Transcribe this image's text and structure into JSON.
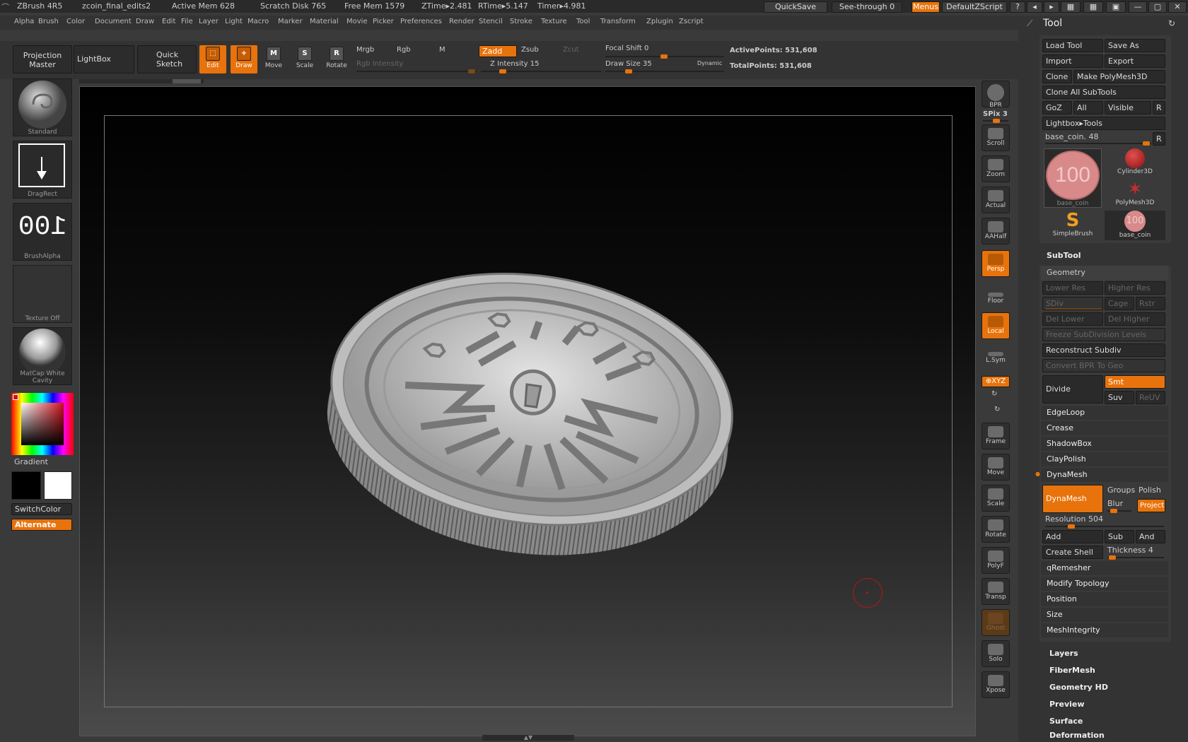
{
  "app": {
    "name": "ZBrush 4R5",
    "document": "zcoin_final_edits2",
    "active_mem": "Active Mem 628",
    "scratch_disk": "Scratch Disk 765",
    "free_mem": "Free Mem 1579",
    "ztime": "ZTime▸2.481",
    "rtime": "RTime▸5.147",
    "timer": "Timer▸4.981",
    "quicksave": "QuickSave",
    "see_through": "See-through  0",
    "menus": "Menus",
    "default_zscript": "DefaultZScript"
  },
  "menubar": [
    "Alpha",
    "Brush",
    "Color",
    "Document",
    "Draw",
    "Edit",
    "File",
    "Layer",
    "Light",
    "Macro",
    "Marker",
    "Material",
    "Movie",
    "Picker",
    "Preferences",
    "Render",
    "Stencil",
    "Stroke",
    "Texture",
    "Tool",
    "Transform",
    "Zplugin",
    "Zscript"
  ],
  "shelf": {
    "projection_master": "Projection\nMaster",
    "lightbox": "LightBox",
    "quick_sketch": "Quick\nSketch",
    "edit": "Edit",
    "draw": "Draw",
    "move": "Move",
    "scale": "Scale",
    "rotate": "Rotate",
    "mrgb": "Mrgb",
    "rgb": "Rgb",
    "m": "M",
    "rgb_intensity": "Rgb Intensity",
    "zadd": "Zadd",
    "zsub": "Zsub",
    "zcut": "Zcut",
    "z_intensity": "Z Intensity 15",
    "focal_shift": "Focal Shift 0",
    "draw_size": "Draw Size 35",
    "dynamic": "Dynamic",
    "active_points": "ActivePoints: 531,608",
    "total_points": "TotalPoints: 531,608",
    "z_intensity_value": 15,
    "z_intensity_max": 100,
    "focal_shift_value": 0,
    "draw_size_value": 35
  },
  "left": {
    "brush": "Standard",
    "stroke": "DragRect",
    "alpha": "BrushAlpha",
    "alpha_glyph": "100",
    "texture": "Texture Off",
    "material": "MatCap White Cavity",
    "gradient": "Gradient",
    "switch_color": "SwitchColor",
    "alternate": "Alternate"
  },
  "right_strip": {
    "bpr": "BPR",
    "spix": "SPix 3",
    "scroll": "Scroll",
    "zoom": "Zoom",
    "actual": "Actual",
    "aahalf": "AAHalf",
    "persp": "Persp",
    "floor": "Floor",
    "local": "Local",
    "lsym": "L.Sym",
    "xyz": "⊕XYZ",
    "frame": "Frame",
    "move": "Move",
    "scale": "Scale",
    "rotate": "Rotate",
    "polyf": "PolyF",
    "transp": "Transp",
    "ghost": "Ghost",
    "solo": "Solo",
    "xpose": "Xpose"
  },
  "tool_panel": {
    "title": "Tool",
    "load_tool": "Load Tool",
    "save_as": "Save As",
    "import": "Import",
    "export": "Export",
    "clone": "Clone",
    "make_polymesh": "Make PolyMesh3D",
    "clone_all": "Clone All SubTools",
    "goz": "GoZ",
    "all": "All",
    "visible": "Visible",
    "r": "R",
    "lightbox_tools": "Lightbox▸Tools",
    "current_tool": "base_coin. 48",
    "thumbs": [
      {
        "label": "base_coin",
        "glyph": "100"
      },
      {
        "label": "Cylinder3D"
      },
      {
        "label": "PolyMesh3D"
      },
      {
        "label": "SimpleBrush"
      },
      {
        "label": "base_coin",
        "glyph": "100"
      }
    ],
    "subtool": "SubTool",
    "geometry": "Geometry",
    "lower_res": "Lower Res",
    "higher_res": "Higher Res",
    "sdiv": "SDiv",
    "cage": "Cage",
    "rstr": "Rstr",
    "del_lower": "Del Lower",
    "del_higher": "Del Higher",
    "freeze": "Freeze SubDivision Levels",
    "reconstruct": "Reconstruct Subdiv",
    "convert_bpr": "Convert BPR To Geo",
    "divide": "Divide",
    "smt": "Smt",
    "suv": "Suv",
    "reuv": "ReUV",
    "edgeloop": "EdgeLoop",
    "crease": "Crease",
    "shadowbox": "ShadowBox",
    "claypolish": "ClayPolish",
    "dynamesh_hdr": "DynaMesh",
    "dynamesh_btn": "DynaMesh",
    "groups": "Groups",
    "polish": "Polish",
    "blur": "Blur",
    "project": "Project",
    "resolution": "Resolution 504",
    "add": "Add",
    "sub": "Sub",
    "and": "And",
    "create_shell": "Create Shell",
    "thickness": "Thickness 4",
    "qremesher": "qRemesher",
    "modify_topology": "Modify Topology",
    "position": "Position",
    "size": "Size",
    "meshintegrity": "MeshIntegrity",
    "layers": "Layers",
    "fibermesh": "FiberMesh",
    "geometry_hd": "Geometry HD",
    "preview": "Preview",
    "surface": "Surface",
    "deformation": "Deformation"
  }
}
